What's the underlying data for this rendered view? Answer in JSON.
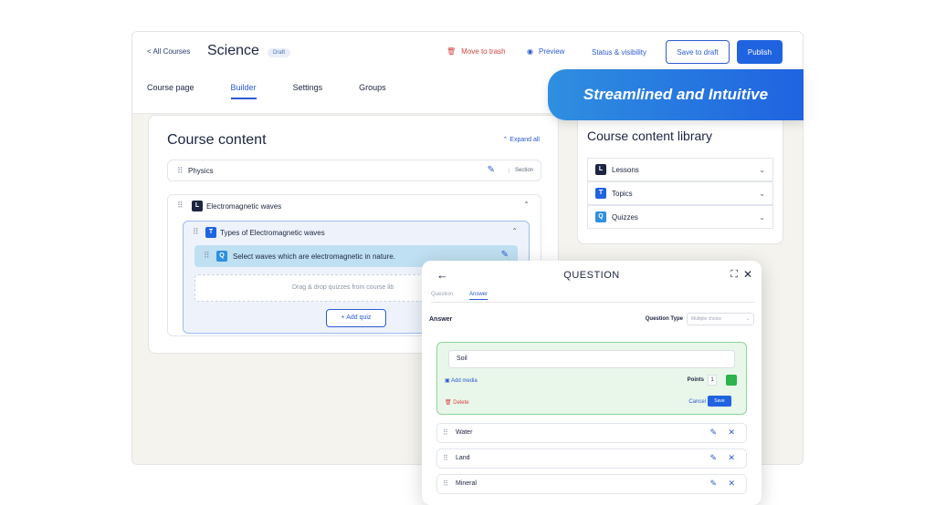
{
  "header": {
    "back_label": "< All Courses",
    "title": "Science",
    "badge": "Draft",
    "trash_label": "Move to trash",
    "preview_label": "Preview",
    "status_label": "Status & visibility",
    "save_draft_label": "Save to draft",
    "publish_label": "Publish"
  },
  "tabs": [
    "Course page",
    "Builder",
    "Settings",
    "Groups"
  ],
  "banner": "Streamlined and Intuitive",
  "course_content": {
    "title": "Course content",
    "expand_label": "Expand all",
    "section_name": "Physics",
    "section_tag": "Section",
    "lesson": "Electromagnetic waves",
    "topic": "Types of Electromagnetic waves",
    "quiz": "Select waves which are electromagnetic in nature.",
    "drop_hint": "Drag & drop quizzes from course lib",
    "add_quiz": "+ Add quiz"
  },
  "library": {
    "title": "Course content library",
    "items": [
      {
        "chip": "L",
        "label": "Lessons"
      },
      {
        "chip": "T",
        "label": "Topics"
      },
      {
        "chip": "Q",
        "label": "Quizzes"
      }
    ]
  },
  "question_modal": {
    "title": "QUESTION",
    "tab_question": "Question",
    "tab_answer": "Answer",
    "answer_label": "Answer",
    "question_type_label": "Question Type",
    "question_type_value": "Multiple choice",
    "editing_answer": "Soil",
    "add_media": "Add media",
    "points_label": "Points",
    "points_value": "1",
    "delete_label": "Delete",
    "cancel_label": "Cancel",
    "save_label": "Save",
    "answers": [
      "Water",
      "Land",
      "Mineral"
    ]
  },
  "colors": {
    "primary": "#1f63e0",
    "danger": "#d64545",
    "success_bg": "#e9f7ea",
    "dark": "#1c2541"
  }
}
